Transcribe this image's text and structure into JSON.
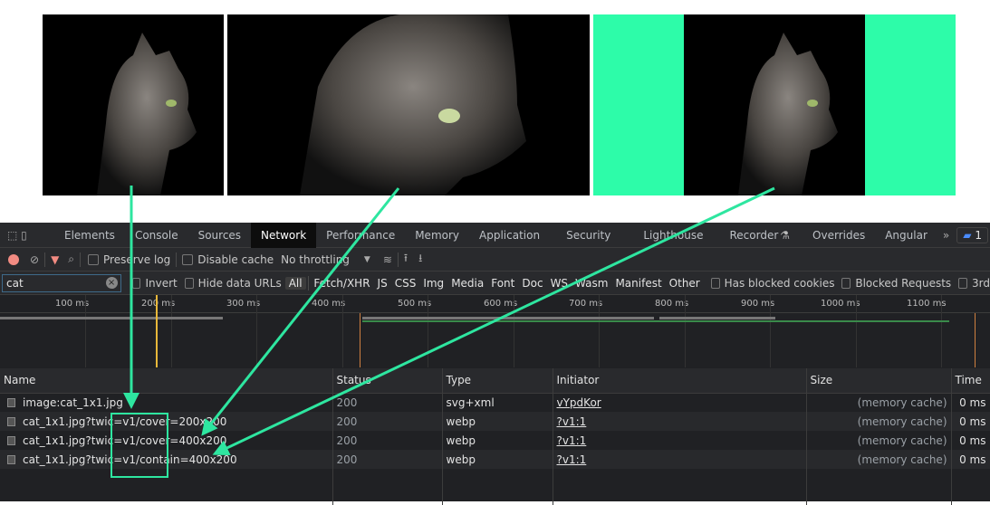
{
  "colors": {
    "accent": "#2dfca9",
    "arrow": "#2ee6a0",
    "devtools_bg": "#202124"
  },
  "tabs": [
    "Elements",
    "Console",
    "Sources",
    "Network",
    "Performance",
    "Memory",
    "Application",
    "Security",
    "Lighthouse",
    "Recorder",
    "Overrides",
    "Angular"
  ],
  "active_tab": "Network",
  "issues_count": "1",
  "toolbar": {
    "preserve_log": "Preserve log",
    "disable_cache": "Disable cache",
    "throttling": "No throttling"
  },
  "filter": {
    "value": "cat",
    "invert": "Invert",
    "hide_data_urls": "Hide data URLs",
    "types": [
      "All",
      "Fetch/XHR",
      "JS",
      "CSS",
      "Img",
      "Media",
      "Font",
      "Doc",
      "WS",
      "Wasm",
      "Manifest",
      "Other"
    ],
    "has_blocked_cookies": "Has blocked cookies",
    "blocked_requests": "Blocked Requests",
    "third_party": "3rd"
  },
  "timeline": {
    "ticks": [
      "100 ms",
      "200 ms",
      "300 ms",
      "400 ms",
      "500 ms",
      "600 ms",
      "700 ms",
      "800 ms",
      "900 ms",
      "1000 ms",
      "1100 ms"
    ]
  },
  "table": {
    "headers": [
      "Name",
      "Status",
      "Type",
      "Initiator",
      "Size",
      "Time"
    ],
    "rows": [
      {
        "name": "image:cat_1x1.jpg",
        "status": "200",
        "type": "svg+xml",
        "initiator": "vYpdKor",
        "size": "(memory cache)",
        "time": "0 ms"
      },
      {
        "name": "cat_1x1.jpg?twic=v1/cover=200x200",
        "status": "200",
        "type": "webp",
        "initiator": "?v1:1",
        "size": "(memory cache)",
        "time": "0 ms"
      },
      {
        "name": "cat_1x1.jpg?twic=v1/cover=400x200",
        "status": "200",
        "type": "webp",
        "initiator": "?v1:1",
        "size": "(memory cache)",
        "time": "0 ms"
      },
      {
        "name": "cat_1x1.jpg?twic=v1/contain=400x200",
        "status": "200",
        "type": "webp",
        "initiator": "?v1:1",
        "size": "(memory cache)",
        "time": "0 ms"
      }
    ]
  }
}
